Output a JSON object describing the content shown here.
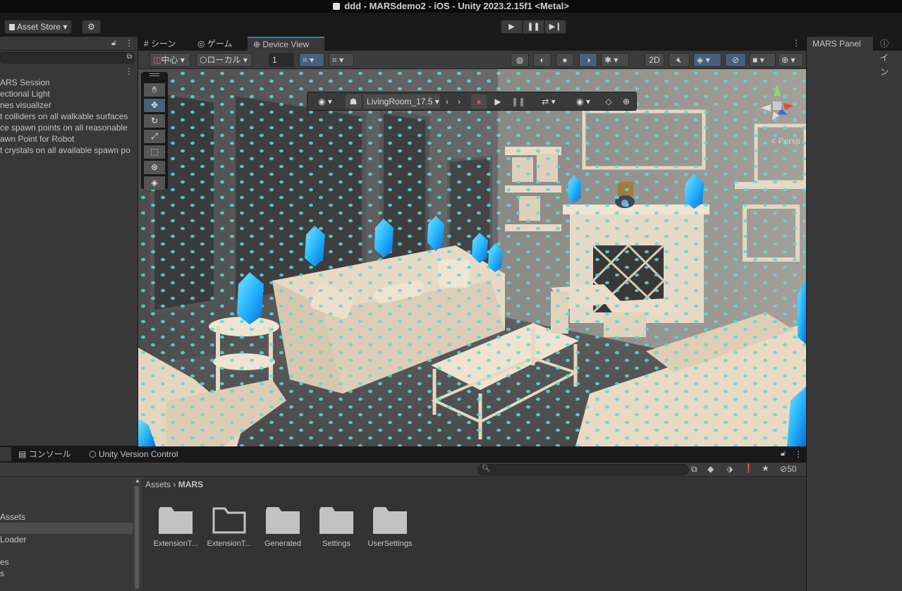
{
  "window": {
    "title": "ddd - MARSdemo2 - iOS - Unity 2023.2.15f1 <Metal>"
  },
  "toolbar": {
    "asset_store_label": "Asset Store ▾",
    "play": "▶",
    "pause": "❚❚",
    "step": "▶❙"
  },
  "hierarchy": {
    "items": [
      "ARS Session",
      "ectional Light",
      "nes visualizer",
      "t colliders on all walkable surfaces",
      "ce spawn points on all reasonable",
      "awn Point for Robot",
      "t crystals on all available spawn po"
    ]
  },
  "scene": {
    "tabs": [
      {
        "icon": "#",
        "label": "シーン"
      },
      {
        "icon": "◎",
        "label": "ゲーム"
      },
      {
        "icon": "⊕",
        "label": "Device View"
      }
    ],
    "toolbar": {
      "pivot": "中心",
      "space": "ローカル",
      "grid_value": "1",
      "mode_2d": "2D"
    },
    "overlay": {
      "environment": "LivingRoom_17.5"
    },
    "persp_label": "< Persp"
  },
  "right_panel": {
    "tabs": [
      "MARS Panel",
      "イン"
    ]
  },
  "bottom": {
    "tabs": [
      "コンソール",
      "Unity Version Control"
    ],
    "hidden_count": "50",
    "breadcrumb": [
      "Assets",
      "MARS"
    ],
    "tree": [
      "Assets",
      "Loader",
      "es",
      "s"
    ],
    "assets": [
      {
        "name": "ExtensionT...",
        "style": "filled"
      },
      {
        "name": "ExtensionT...",
        "style": "outline"
      },
      {
        "name": "Generated",
        "style": "filled"
      },
      {
        "name": "Settings",
        "style": "filled"
      },
      {
        "name": "UserSettings",
        "style": "filled"
      }
    ]
  },
  "colors": {
    "accent": "#3a79bb",
    "panel": "#383838",
    "background": "#191919",
    "crystal": "#27b7ff",
    "furniture": "#e7d8c3"
  }
}
